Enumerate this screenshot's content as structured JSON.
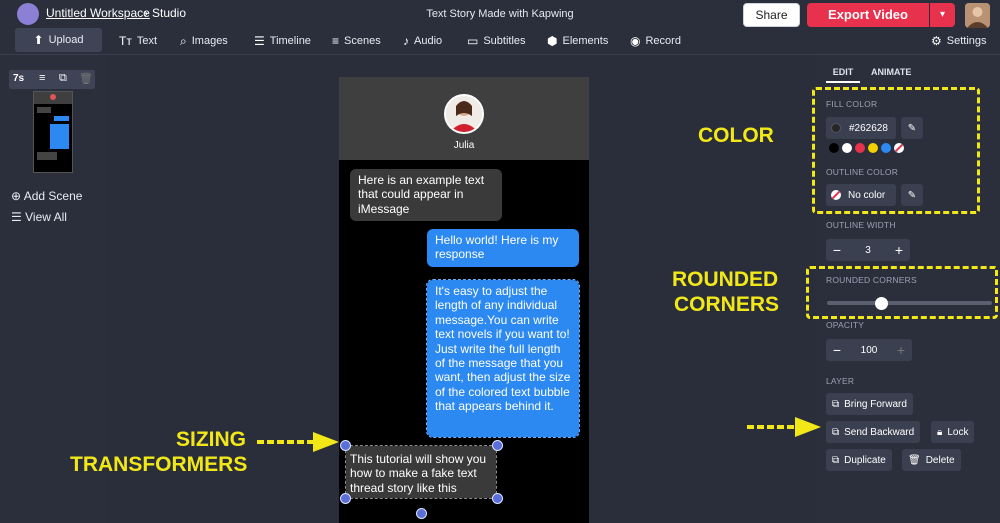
{
  "breadcrumb": {
    "workspace": "Untitled Workspace",
    "separator": "›",
    "section": "Studio"
  },
  "doc_title": "Text Story Made with Kapwing",
  "topbar": {
    "share": "Share",
    "export": "Export Video",
    "export_dd": "▾"
  },
  "toolbar": [
    {
      "label": "Upload",
      "icon": "⬆"
    },
    {
      "label": "Text",
      "icon": "Tт"
    },
    {
      "label": "Images",
      "icon": "⌕"
    },
    {
      "label": "Timeline",
      "icon": "☰"
    },
    {
      "label": "Scenes",
      "icon": "≡"
    },
    {
      "label": "Audio",
      "icon": "♪"
    },
    {
      "label": "Subtitles",
      "icon": "▭"
    },
    {
      "label": "Elements",
      "icon": "⬢"
    },
    {
      "label": "Record",
      "icon": "◉"
    }
  ],
  "settings": {
    "label": "Settings",
    "icon": "⚙"
  },
  "scene": {
    "duration": "7s"
  },
  "left_links": {
    "add_scene": "Add Scene",
    "view_all": "View All"
  },
  "phone": {
    "contact": "Julia",
    "messages": [
      "Here is an example text that could appear in iMessage",
      "Hello world! Here is my response",
      "It's easy to adjust the length of any individual message.You can write text novels if you want to! Just write the full length of the message that you want, then adjust the size of the colored text bubble that appears behind it.",
      "This tutorial will show you how to make  a fake text thread story like this"
    ]
  },
  "panel": {
    "tabs": {
      "edit": "EDIT",
      "animate": "ANIMATE"
    },
    "fill_color_label": "FILL COLOR",
    "fill_color_value": "#262628",
    "swatches": [
      "#000000",
      "#ffffff",
      "#e8314d",
      "#f2d100",
      "#2c89f2"
    ],
    "outline_color_label": "OUTLINE COLOR",
    "outline_color_value": "No color",
    "outline_width_label": "OUTLINE WIDTH",
    "outline_width_value": "3",
    "rounded_label": "ROUNDED CORNERS",
    "rounded_level": 0.33,
    "opacity_label": "OPACITY",
    "opacity_value": "100",
    "layer_label": "LAYER",
    "bring_forward": "Bring Forward",
    "send_backward": "Send Backward",
    "lock": "Lock",
    "duplicate": "Duplicate",
    "delete": "Delete"
  },
  "annotations": {
    "color": "COLOR",
    "rounded_1": "ROUNDED",
    "rounded_2": "CORNERS",
    "sizing_1": "SIZING",
    "sizing_2": "TRANSFORMERS",
    "accent": "#f2e817"
  }
}
